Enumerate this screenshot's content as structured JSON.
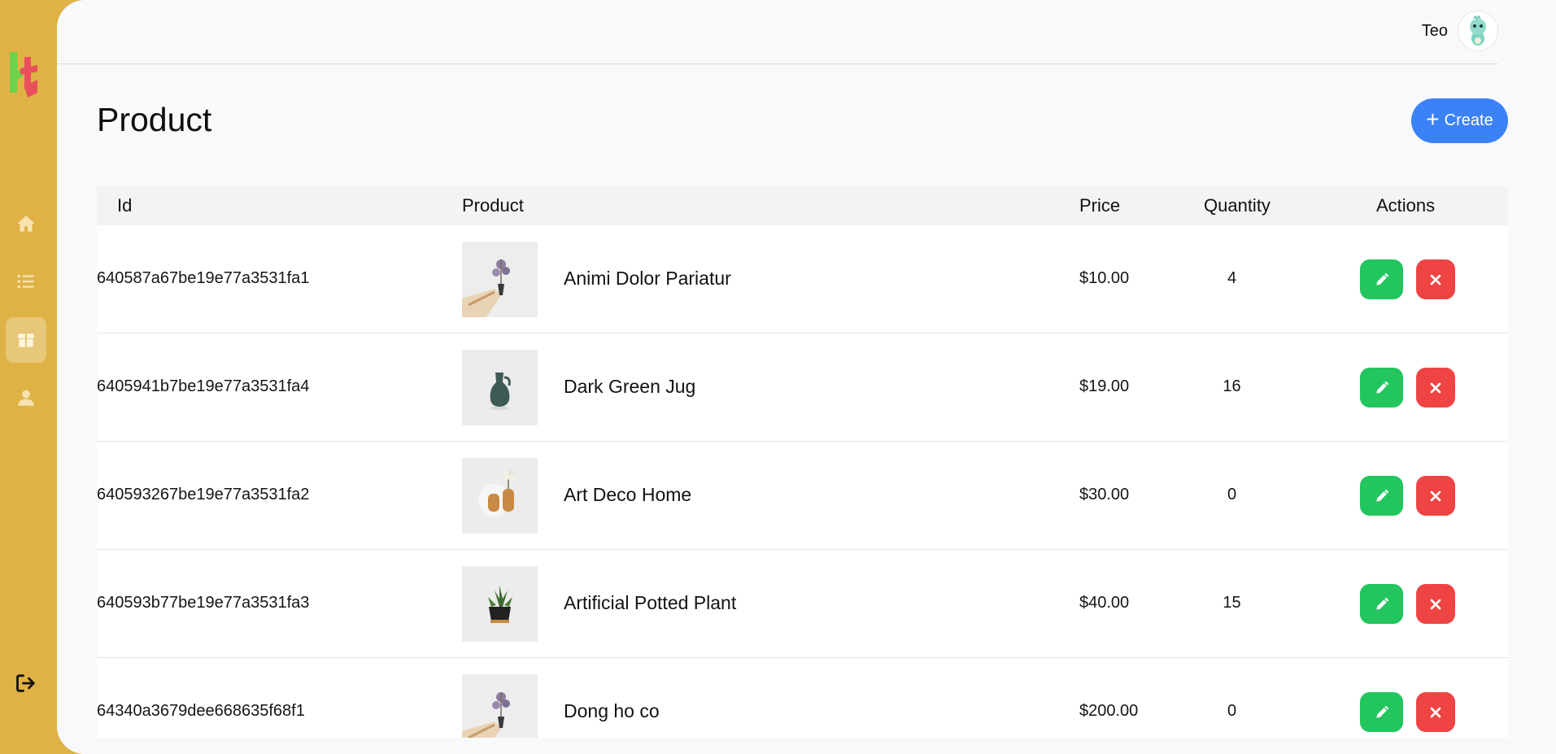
{
  "app": {
    "logo_icon": "ht-logo",
    "accent_color": "#dfb246"
  },
  "sidebar": {
    "items": [
      {
        "icon": "home-icon",
        "active": false
      },
      {
        "icon": "list-icon",
        "active": false
      },
      {
        "icon": "box-icon",
        "active": true
      },
      {
        "icon": "user-icon",
        "active": false
      }
    ],
    "logout_icon": "logout-icon"
  },
  "header": {
    "username": "Teo",
    "avatar_icon": "avatar-icon"
  },
  "page": {
    "title": "Product",
    "create_label": "Create"
  },
  "table": {
    "columns": [
      "Id",
      "Product",
      "Price",
      "Quantity",
      "Actions"
    ],
    "rows": [
      {
        "id": "640587a67be19e77a3531fa1",
        "name": "Animi Dolor Pariatur",
        "price": "$10.00",
        "quantity": "4",
        "image": "flower-bouquet"
      },
      {
        "id": "6405941b7be19e77a3531fa4",
        "name": "Dark Green Jug",
        "price": "$19.00",
        "quantity": "16",
        "image": "green-jug"
      },
      {
        "id": "640593267be19e77a3531fa2",
        "name": "Art Deco Home",
        "price": "$30.00",
        "quantity": "0",
        "image": "deco-vases"
      },
      {
        "id": "640593b77be19e77a3531fa3",
        "name": "Artificial Potted Plant",
        "price": "$40.00",
        "quantity": "15",
        "image": "potted-plant"
      },
      {
        "id": "64340a3679dee668635f68f1",
        "name": "Dong ho co",
        "price": "$200.00",
        "quantity": "0",
        "image": "flower-bouquet"
      }
    ],
    "action_colors": {
      "edit": "#22c55e",
      "delete": "#ef4444"
    }
  }
}
